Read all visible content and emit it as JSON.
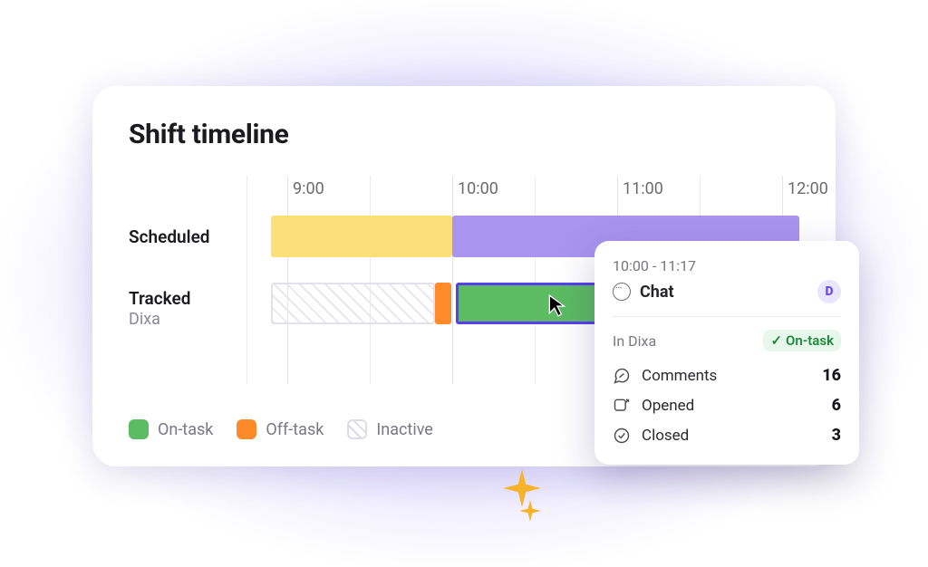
{
  "title": "Shift timeline",
  "hours": [
    "9:00",
    "10:00",
    "11:00",
    "12:00"
  ],
  "rows": {
    "scheduled_label": "Scheduled",
    "tracked_label": "Tracked",
    "tracked_sublabel": "Dixa"
  },
  "legend": {
    "on_task": "On-task",
    "off_task": "Off-task",
    "inactive": "Inactive"
  },
  "tooltip": {
    "range": "10:00 - 11:17",
    "channel": "Chat",
    "brand_letter": "D",
    "context_label": "In Dixa",
    "status_label": "On-task",
    "metrics": {
      "comments_label": "Comments",
      "comments_value": "16",
      "opened_label": "Opened",
      "opened_value": "6",
      "closed_label": "Closed",
      "closed_value": "3"
    }
  },
  "colors": {
    "yellow": "#fddf7a",
    "purple": "#a995f0",
    "green": "#5dbb63",
    "orange": "#ff8a2a",
    "accent": "#6b4df0"
  },
  "chart_data": {
    "type": "bar",
    "title": "Shift timeline",
    "xlabel": "",
    "ylabel": "",
    "x_ticks": [
      "9:00",
      "10:00",
      "11:00",
      "12:00"
    ],
    "x_range_hours": [
      8.75,
      12.5
    ],
    "series": [
      {
        "name": "Scheduled (yellow)",
        "row": "Scheduled",
        "start": 8.9,
        "end": 10.0,
        "state": "yellow"
      },
      {
        "name": "Scheduled (purple)",
        "row": "Scheduled",
        "start": 10.0,
        "end": 12.5,
        "state": "purple"
      },
      {
        "name": "Tracked inactive",
        "row": "Tracked",
        "start": 8.9,
        "end": 9.9,
        "state": "inactive"
      },
      {
        "name": "Tracked off-task",
        "row": "Tracked",
        "start": 9.9,
        "end": 10.0,
        "state": "off-task"
      },
      {
        "name": "Tracked on-task",
        "row": "Tracked",
        "start": 10.02,
        "end": 11.28,
        "state": "on-task",
        "selected": true
      }
    ]
  }
}
